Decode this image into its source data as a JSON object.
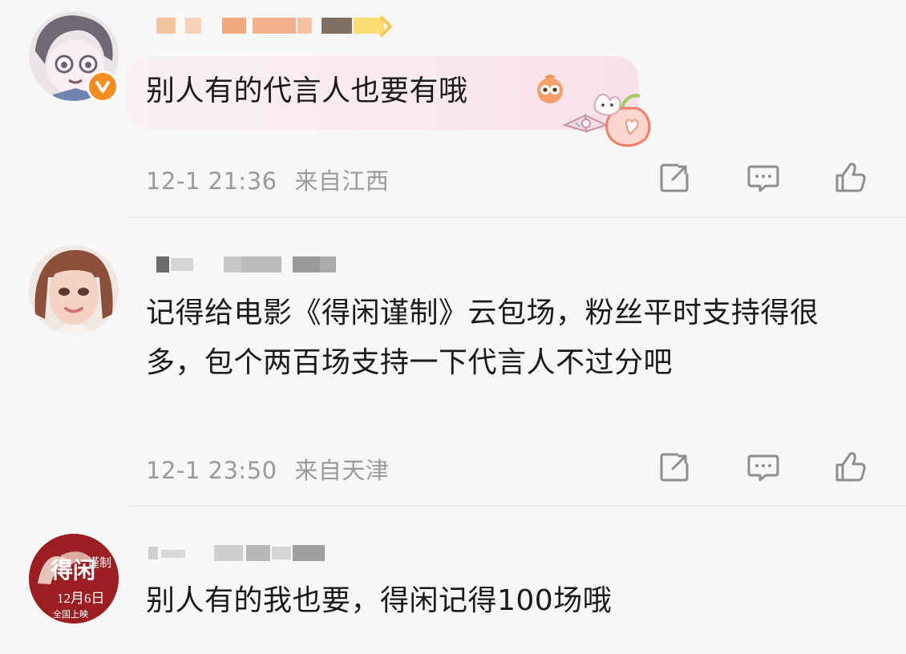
{
  "comments": [
    {
      "text": "别人有的代言人也要有哦",
      "date": "12-1 21:36",
      "location": "来自江西"
    },
    {
      "text": "记得给电影《得闲谨制》云包场，粉丝平时支持得很多，包个两百场支持一下代言人不过分吧",
      "date": "12-1 23:50",
      "location": "来自天津"
    },
    {
      "text": "别人有的我也要，得闲记得100场哦"
    }
  ],
  "avatar_logo": {
    "title_chars": "得闲",
    "title_side": "谨制",
    "date": "12月6日",
    "sub": "全国上映"
  }
}
